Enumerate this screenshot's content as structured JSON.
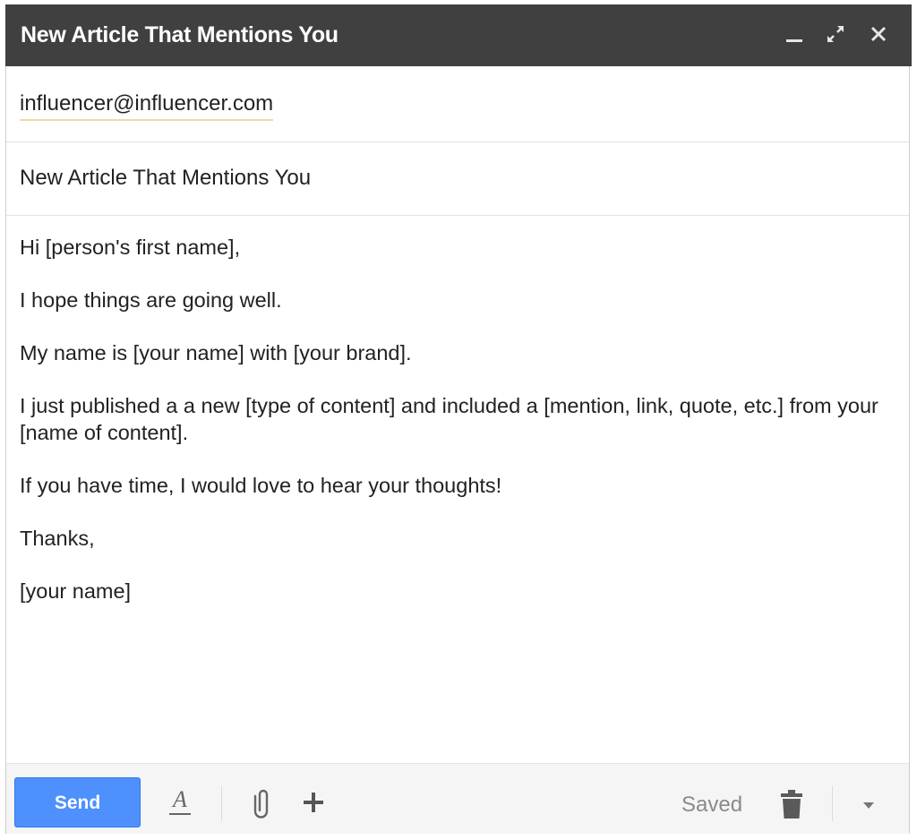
{
  "window": {
    "title": "New Article That Mentions You",
    "minimize_icon": "minimize-icon",
    "popout_icon": "expand-icon",
    "close_icon": "close-icon"
  },
  "fields": {
    "to_recipient": "influencer@influencer.com",
    "subject": "New Article That Mentions You"
  },
  "message": {
    "paragraphs": [
      "Hi [person's first name],",
      "I hope things are going well.",
      "My name is [your name] with [your brand].",
      "I just published a a new [type of content] and included a [mention, link, quote, etc.] from your [name of content].",
      "If you have time, I would love to hear your thoughts!",
      "Thanks,",
      "[your name]"
    ]
  },
  "toolbar": {
    "send_label": "Send",
    "formatting_icon": "text-format-icon",
    "attach_icon": "paperclip-icon",
    "insert_icon": "plus-icon",
    "status": "Saved",
    "discard_icon": "trash-icon",
    "more_icon": "chevron-down-icon"
  },
  "colors": {
    "titlebar_bg": "#404040",
    "send_button": "#4d90fe",
    "toolbar_bg": "#f5f5f5"
  }
}
